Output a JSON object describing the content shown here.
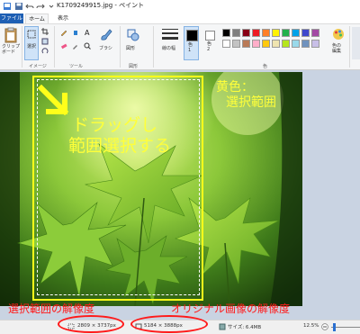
{
  "titlebar": {
    "title": "K1709249915.jpg - ペイント"
  },
  "menu": {
    "file": "ファイル",
    "home": "ホーム",
    "view": "表示"
  },
  "ribbon": {
    "clipboard_label": "クリップ\nボード",
    "select_label": "選択",
    "brush_label": "ブラシ",
    "shapes_label": "図形",
    "line_width_label": "線の幅",
    "color1_label": "色\n1",
    "color2_label": "色\n2",
    "edit_colors_label": "色の\n編集",
    "group_image": "イメージ",
    "group_tools": "ツール",
    "group_shapes": "図形",
    "group_colors": "色",
    "colors_row1": [
      "#000000",
      "#7f7f7f",
      "#880015",
      "#ed1c24",
      "#ff7f27",
      "#fff200",
      "#22b14c",
      "#00a2e8",
      "#3f48cc",
      "#a349a4"
    ],
    "colors_row2": [
      "#ffffff",
      "#c3c3c3",
      "#b97a57",
      "#ffaec9",
      "#ffc90e",
      "#efe4b0",
      "#b5e61d",
      "#99d9ea",
      "#7092be",
      "#c8bfe7"
    ]
  },
  "annotations": {
    "drag_text_line1": "ドラッグし",
    "drag_text_line2": "範囲選択する",
    "yellow_note_line1": "黄色：",
    "yellow_note_line2": "選択範囲",
    "selection_resolution_label": "選択範囲の解像度",
    "original_resolution_label": "オリジナル画像の解像度"
  },
  "status": {
    "selection_size": "2809 × 3737px",
    "image_size": "5184 × 3888px",
    "file_size": "サイズ: 6.4MB",
    "zoom": "12.5%"
  },
  "colors": {
    "accent": "#1e5fb4",
    "annotation_red": "#ff1a1a",
    "annotation_yellow": "#ffff3a"
  }
}
